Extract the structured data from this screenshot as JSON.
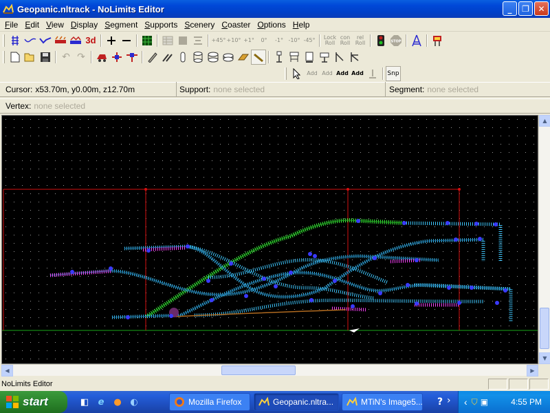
{
  "window": {
    "title": "Geopanic.nltrack - NoLimits Editor",
    "app_icon": "coaster-icon"
  },
  "menu": [
    "File",
    "Edit",
    "View",
    "Display",
    "Segment",
    "Supports",
    "Scenery",
    "Coaster",
    "Options",
    "Help"
  ],
  "toolbar1": {
    "bank_labels": [
      "+45°",
      "+10°",
      "+1°",
      "0°",
      "-1°",
      "-10°",
      "-45°"
    ],
    "lock_roll": "Lock Roll",
    "con_roll": "con Roll",
    "rel_roll": "rel Roll",
    "view_3d": "3d",
    "stop": "STOP"
  },
  "toolbar3": {
    "add_labels": [
      "Add",
      "Add",
      "Add",
      "Add"
    ],
    "snap": "Snp"
  },
  "status": {
    "cursor_label": "Cursor:",
    "cursor_value": "x53.70m, y0.00m, z12.70m",
    "support_label": "Support:",
    "support_value": "none selected",
    "segment_label": "Segment:",
    "segment_value": "none selected",
    "vertex_label": "Vertex:",
    "vertex_value": "none selected"
  },
  "app_status": "NoLimits Editor",
  "taskbar": {
    "start": "start",
    "tasks": [
      "Mozilla Firefox",
      "Geopanic.nltra...",
      "MTiN's Image5..."
    ],
    "clock": "4:55 PM"
  },
  "colors": {
    "title_blue": "#0048d8",
    "viewport_bg": "#000000",
    "track_cyan": "#3fc8ff",
    "track_green": "#40ff40",
    "track_magenta": "#ff40ff",
    "support_red": "#d81010",
    "ground_green": "#107010"
  }
}
